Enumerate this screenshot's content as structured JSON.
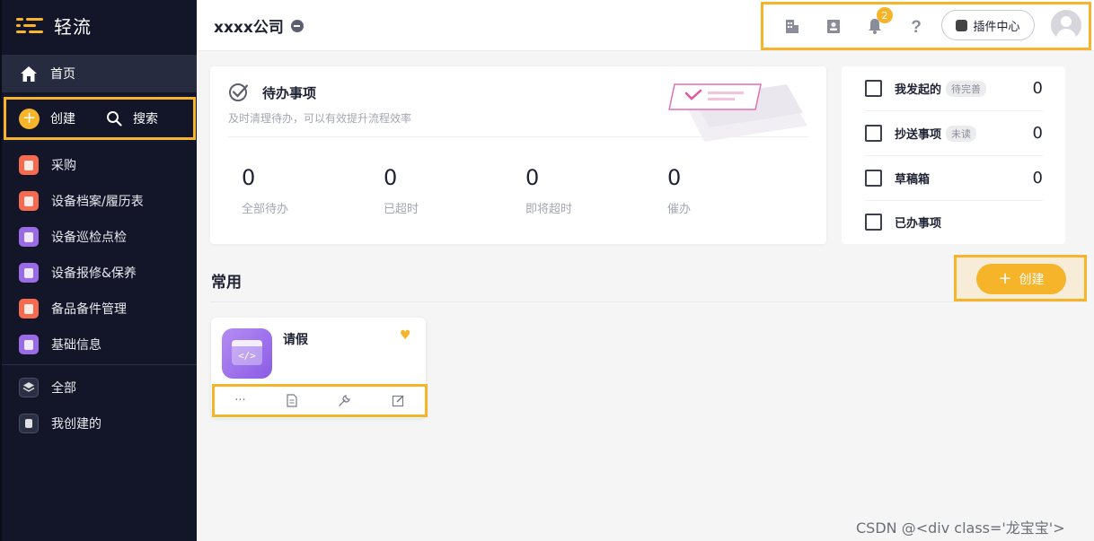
{
  "app": {
    "name": "轻流"
  },
  "sidebar": {
    "home_label": "首页",
    "create_label": "创建",
    "search_label": "搜索",
    "items": [
      {
        "label": "采购",
        "icon": "building-icon",
        "color": "#f46b4f"
      },
      {
        "label": "设备档案/履历表",
        "icon": "document-icon",
        "color": "#f46b4f"
      },
      {
        "label": "设备巡检点检",
        "icon": "portrait-icon",
        "color": "#9b6be6"
      },
      {
        "label": "设备报修&保养",
        "icon": "robot-icon",
        "color": "#9b6be6"
      },
      {
        "label": "备品备件管理",
        "icon": "document-icon",
        "color": "#f46b4f"
      },
      {
        "label": "基础信息",
        "icon": "robot-icon",
        "color": "#9b6be6"
      }
    ],
    "bottom_items": [
      {
        "label": "全部",
        "icon": "layers-icon"
      },
      {
        "label": "我创建的",
        "icon": "clipboard-icon"
      }
    ]
  },
  "header": {
    "company": "xxxx公司",
    "notification_count": "2",
    "plugin_label": "插件中心"
  },
  "todo": {
    "title": "待办事项",
    "subtitle": "及时清理待办，可以有效提升流程效率",
    "stats": [
      {
        "value": "0",
        "label": "全部待办"
      },
      {
        "value": "0",
        "label": "已超时"
      },
      {
        "value": "0",
        "label": "即将超时"
      },
      {
        "value": "0",
        "label": "催办"
      }
    ]
  },
  "right_panel": {
    "items": [
      {
        "label": "我发起的",
        "tag": "待完善",
        "count": "0"
      },
      {
        "label": "抄送事项",
        "tag": "未读",
        "count": "0"
      },
      {
        "label": "草稿箱",
        "tag": "",
        "count": "0"
      },
      {
        "label": "已办事项",
        "tag": "",
        "count": ""
      }
    ]
  },
  "common": {
    "title": "常用",
    "create_label": "创建",
    "apps": [
      {
        "name": "请假",
        "icon_code": "</>"
      }
    ],
    "actions": [
      "···",
      "form-icon",
      "wrench-icon",
      "edit-icon"
    ]
  },
  "watermark": "CSDN @<div class='龙宝宝'>",
  "colors": {
    "accent": "#f5b42a",
    "sidebar": "#131629"
  }
}
